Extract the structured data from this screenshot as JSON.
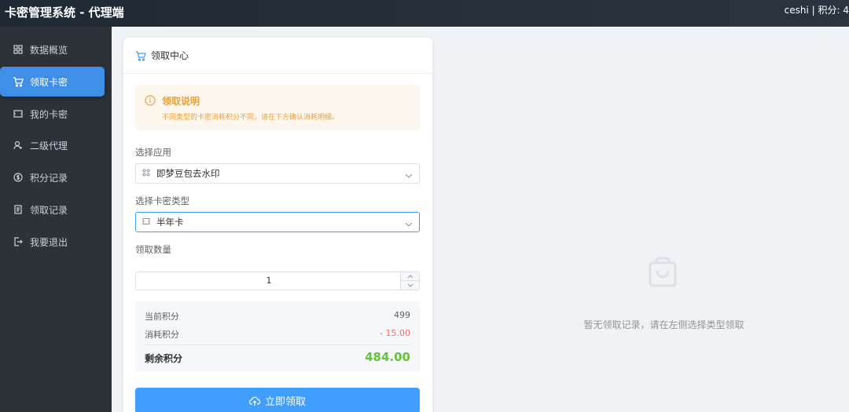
{
  "header": {
    "title": "卡密管理系统 - 代理端",
    "user_info": "ceshi | 积分: 4"
  },
  "sidebar": {
    "items": [
      {
        "label": "数据概览",
        "icon": "dashboard-icon"
      },
      {
        "label": "领取卡密",
        "icon": "cart-icon",
        "active": true
      },
      {
        "label": "我的卡密",
        "icon": "ticket-icon"
      },
      {
        "label": "二级代理",
        "icon": "user-icon"
      },
      {
        "label": "积分记录",
        "icon": "coin-icon"
      },
      {
        "label": "领取记录",
        "icon": "document-icon"
      },
      {
        "label": "我要退出",
        "icon": "logout-icon"
      }
    ]
  },
  "card": {
    "title": "领取中心",
    "notice": {
      "title": "领取说明",
      "desc": "不同类型的卡密消耗积分不同，请在下方确认消耗明细。"
    },
    "app_select": {
      "label": "选择应用",
      "value": "即梦豆包去水印"
    },
    "type_select": {
      "label": "选择卡密类型",
      "value": "半年卡"
    },
    "quantity": {
      "label": "领取数量",
      "value": "1"
    },
    "summary": {
      "current_label": "当前积分",
      "current_value": "499",
      "cost_label": "消耗积分",
      "cost_value": "- 15.00",
      "remaining_label": "剩余积分",
      "remaining_value": "484.00"
    },
    "submit_label": "立即领取"
  },
  "empty": {
    "text": "暂无领取记录，请在左侧选择类型领取"
  },
  "colors": {
    "accent": "#409eff",
    "warning": "#e6a23c",
    "success": "#67c23a",
    "danger": "#f56c6c"
  }
}
